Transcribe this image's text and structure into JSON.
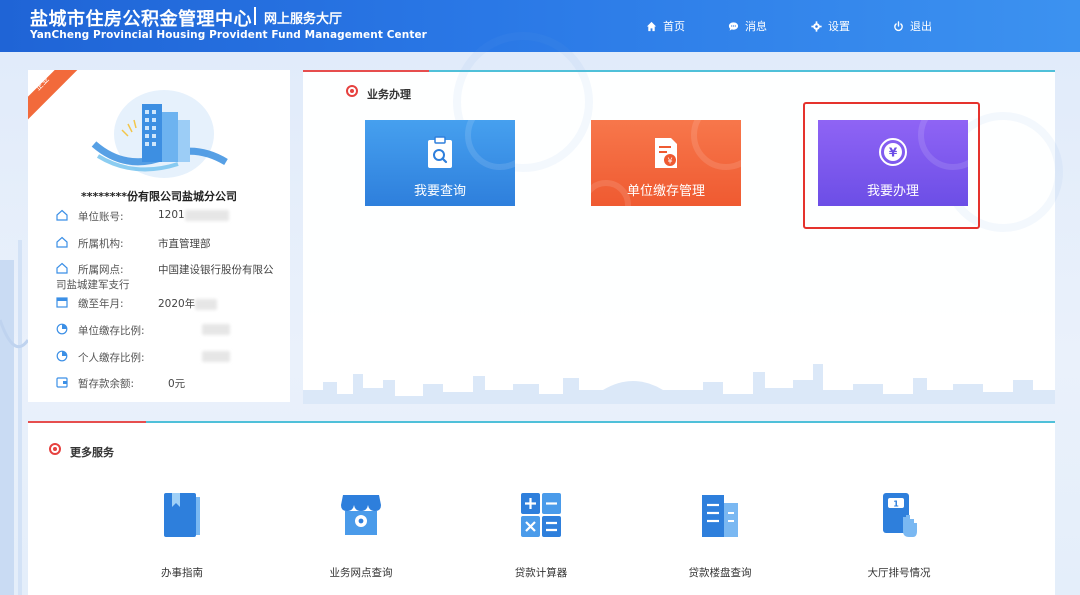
{
  "header": {
    "title": "盐城市住房公积金管理中心",
    "hall": "网上服务大厅",
    "subtitle": "YanCheng Provincial Housing Provident Fund Management Center",
    "nav": {
      "home": "首页",
      "messages": "消息",
      "settings": "设置",
      "exit": "退出"
    }
  },
  "profile": {
    "ribbon": "企业",
    "company_name": "********份有限公司盐城分公司",
    "fields": {
      "account_label": "单位账号:",
      "account_value": "1201",
      "org_label": "所属机构:",
      "org_value": "市直管理部",
      "branch_label": "所属网点:",
      "branch_value_line1": "中国建设银行股份有限公",
      "branch_value_line2": "司盐城建军支行",
      "paid_label": "缴至年月:",
      "paid_value": "2020年",
      "unit_ratio_label": "单位缴存比例:",
      "personal_ratio_label": "个人缴存比例:",
      "balance_label": "暂存款余额:",
      "balance_value": "0元"
    }
  },
  "business": {
    "title": "业务办理",
    "tiles": {
      "query": "我要查询",
      "deposit": "单位缴存管理",
      "handle": "我要办理"
    }
  },
  "more_services": {
    "title": "更多服务",
    "items": {
      "guide": "办事指南",
      "outlets": "业务网点查询",
      "calculator": "贷款计算器",
      "buildings": "贷款楼盘查询",
      "queue": "大厅排号情况"
    }
  },
  "colors": {
    "header": "#2a78e6",
    "query_tile": "#3b8fe6",
    "deposit_tile": "#f26a3b",
    "handle_tile": "#7c58ef",
    "highlight": "#e5322d",
    "section_dot": "#e6413f",
    "accent_line": "#4fc0d9"
  }
}
